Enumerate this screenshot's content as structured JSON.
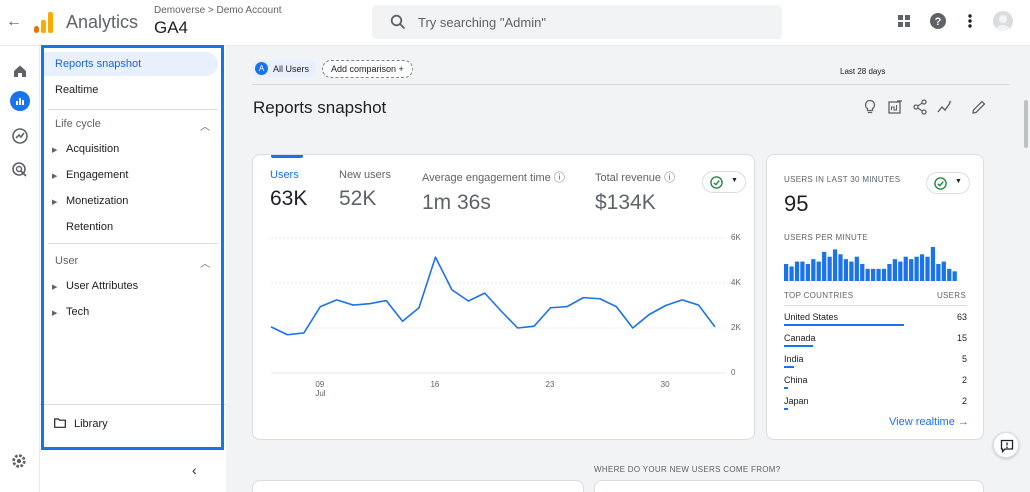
{
  "header": {
    "app_name": "Analytics",
    "account_breadcrumb": "Demoverse > Demo Account",
    "property_name": "GA4",
    "search_placeholder": "Try searching \"Admin\"",
    "icons": [
      "apps-grid-icon",
      "help-icon",
      "more-vert-icon",
      "account-avatar"
    ]
  },
  "rail": {
    "icons": [
      "home-icon",
      "reports-icon",
      "explore-icon",
      "advertising-icon",
      "settings-icon"
    ],
    "active": "reports-icon"
  },
  "nav": {
    "reports_snapshot": "Reports snapshot",
    "realtime": "Realtime",
    "lifecycle": {
      "label": "Life cycle",
      "items": [
        "Acquisition",
        "Engagement",
        "Monetization",
        "Retention"
      ]
    },
    "user": {
      "label": "User",
      "items": [
        "User Attributes",
        "Tech"
      ]
    },
    "library": "Library"
  },
  "toolbar": {
    "all_users_letter": "A",
    "all_users": "All Users",
    "add_comparison": "Add comparison +",
    "date_range": "Last 28 days",
    "page_title": "Reports snapshot"
  },
  "metrics": [
    {
      "label": "Users",
      "value": "63K",
      "active": true
    },
    {
      "label": "New users",
      "value": "52K"
    },
    {
      "label": "Average engagement time ⓘ",
      "value": "1m 36s"
    },
    {
      "label": "Total revenue ⓘ",
      "value": "$134K"
    }
  ],
  "chart_data": {
    "type": "line",
    "x": [
      "Jul 6",
      "Jul 7",
      "Jul 8",
      "Jul 9",
      "Jul 10",
      "Jul 11",
      "Jul 12",
      "Jul 13",
      "Jul 14",
      "Jul 15",
      "Jul 16",
      "Jul 17",
      "Jul 18",
      "Jul 19",
      "Jul 20",
      "Jul 21",
      "Jul 22",
      "Jul 23",
      "Jul 24",
      "Jul 25",
      "Jul 26",
      "Jul 27",
      "Jul 28",
      "Jul 29",
      "Jul 30",
      "Jul 31",
      "Aug 1",
      "Aug 2"
    ],
    "series": [
      {
        "values": [
          2050,
          1700,
          1780,
          2950,
          3250,
          3020,
          3080,
          3220,
          2300,
          2900,
          5150,
          3700,
          3200,
          3550,
          2750,
          2000,
          2080,
          2900,
          2950,
          3350,
          3300,
          2950,
          2000,
          2600,
          3000,
          3250,
          3020,
          2050
        ]
      }
    ],
    "x_tick_labels": [
      {
        "line1": "09",
        "line2": "Jul"
      },
      {
        "line1": "16",
        "line2": ""
      },
      {
        "line1": "23",
        "line2": ""
      },
      {
        "line1": "30",
        "line2": ""
      }
    ],
    "y_tick_labels": [
      "6K",
      "4K",
      "2K",
      "0"
    ],
    "ylim": [
      0,
      6000
    ],
    "grid": true,
    "color": "#1a73e8"
  },
  "realtime": {
    "title": "USERS IN LAST 30 MINUTES",
    "value": "95",
    "per_minute_label": "USERS PER MINUTE",
    "per_minute": [
      7,
      6,
      8,
      8,
      7,
      9,
      8,
      12,
      10,
      13,
      11,
      9,
      8,
      10,
      7,
      5,
      5,
      5,
      5,
      7,
      9,
      8,
      10,
      9,
      10,
      11,
      10,
      14,
      7,
      8,
      5,
      4
    ],
    "countries_header": "TOP COUNTRIES",
    "users_header": "USERS",
    "countries": [
      {
        "name": "United States",
        "users": "63",
        "share": 1.0
      },
      {
        "name": "Canada",
        "users": "15",
        "share": 0.24
      },
      {
        "name": "India",
        "users": "5",
        "share": 0.08
      },
      {
        "name": "China",
        "users": "2",
        "share": 0.03
      },
      {
        "name": "Japan",
        "users": "2",
        "share": 0.03
      }
    ],
    "view_link": "View realtime →"
  },
  "bottom_heading": "WHERE DO YOUR NEW USERS COME FROM?",
  "colors": {
    "accent": "#1a73e8",
    "nav_outline": "#1a73e8",
    "active_nav_bg": "#e8f0fe"
  }
}
